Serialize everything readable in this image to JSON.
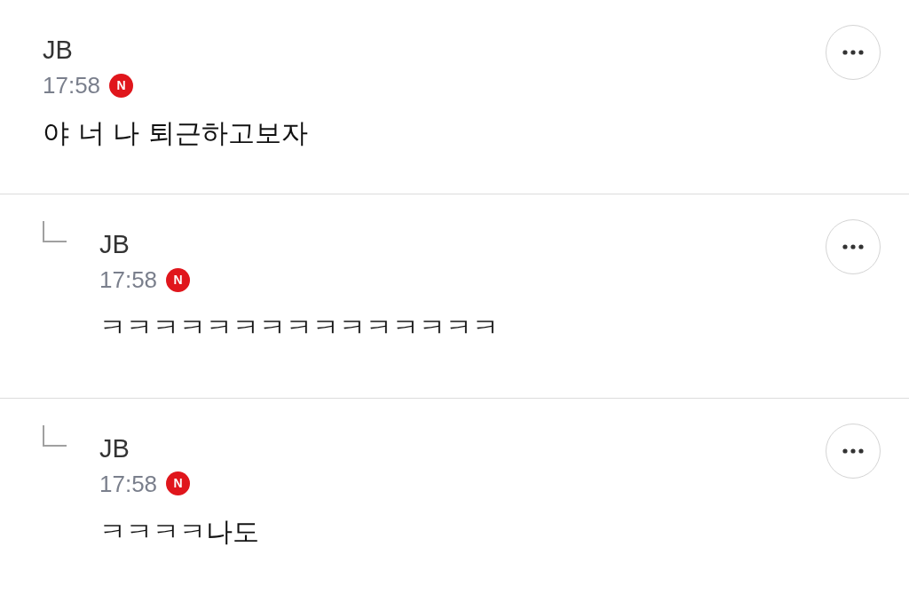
{
  "comments": [
    {
      "kind": "comment",
      "author": "JB",
      "time": "17:58",
      "badge": "N",
      "text": "야 너 나 퇴근하고보자"
    },
    {
      "kind": "reply",
      "author": "JB",
      "time": "17:58",
      "badge": "N",
      "text": "ㅋㅋㅋㅋㅋㅋㅋㅋㅋㅋㅋㅋㅋㅋㅋ"
    },
    {
      "kind": "reply",
      "author": "JB",
      "time": "17:58",
      "badge": "N",
      "text": "ㅋㅋㅋㅋ나도"
    }
  ]
}
